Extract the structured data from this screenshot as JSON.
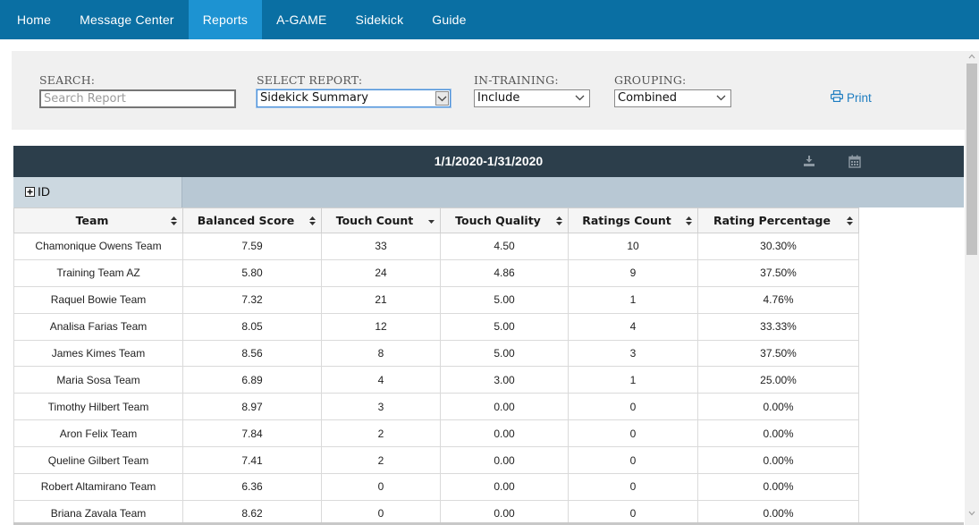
{
  "nav": {
    "items": [
      {
        "label": "Home",
        "active": false
      },
      {
        "label": "Message Center",
        "active": false
      },
      {
        "label": "Reports",
        "active": true
      },
      {
        "label": "A-GAME",
        "active": false
      },
      {
        "label": "Sidekick",
        "active": false
      },
      {
        "label": "Guide",
        "active": false
      }
    ]
  },
  "filters": {
    "search_label": "SEARCH:",
    "search_placeholder": "Search Report",
    "report_label": "SELECT REPORT:",
    "report_value": "Sidekick Summary",
    "training_label": "IN-TRAINING:",
    "training_value": "Include",
    "grouping_label": "GROUPING:",
    "grouping_value": "Combined",
    "print_label": "Print"
  },
  "report": {
    "date_range": "1/1/2020-1/31/2020",
    "group_label": "ID",
    "columns": [
      "Team",
      "Balanced Score",
      "Touch Count",
      "Touch Quality",
      "Ratings Count",
      "Rating Percentage"
    ],
    "rows": [
      [
        "Chamonique Owens Team",
        "7.59",
        "33",
        "4.50",
        "10",
        "30.30%"
      ],
      [
        "Training Team AZ",
        "5.80",
        "24",
        "4.86",
        "9",
        "37.50%"
      ],
      [
        "Raquel Bowie Team",
        "7.32",
        "21",
        "5.00",
        "1",
        "4.76%"
      ],
      [
        "Analisa Farias Team",
        "8.05",
        "12",
        "5.00",
        "4",
        "33.33%"
      ],
      [
        "James Kimes Team",
        "8.56",
        "8",
        "5.00",
        "3",
        "37.50%"
      ],
      [
        "Maria Sosa Team",
        "6.89",
        "4",
        "3.00",
        "1",
        "25.00%"
      ],
      [
        "Timothy Hilbert Team",
        "8.97",
        "3",
        "0.00",
        "0",
        "0.00%"
      ],
      [
        "Aron Felix Team",
        "7.84",
        "2",
        "0.00",
        "0",
        "0.00%"
      ],
      [
        "Queline Gilbert Team",
        "7.41",
        "2",
        "0.00",
        "0",
        "0.00%"
      ],
      [
        "Robert Altamirano Team",
        "6.36",
        "0",
        "0.00",
        "0",
        "0.00%"
      ],
      [
        "Briana Zavala Team",
        "8.62",
        "0",
        "0.00",
        "0",
        "0.00%"
      ]
    ]
  },
  "colors": {
    "nav_bg": "#0a6fa3",
    "nav_active": "#1d93d2",
    "header_bar": "#2c3e4b",
    "link": "#1e7dc0"
  }
}
